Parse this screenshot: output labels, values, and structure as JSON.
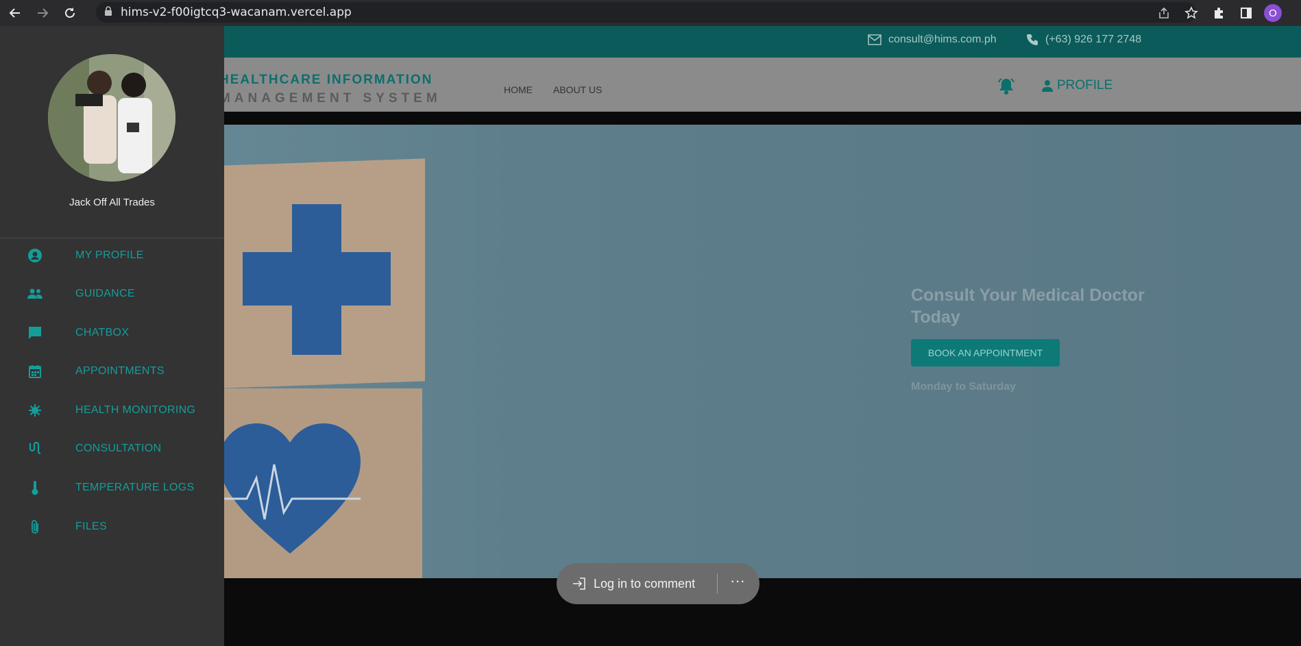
{
  "browser": {
    "url": "hims-v2-f00igtcq3-wacanam.vercel.app",
    "profile_initial": "O"
  },
  "topbar": {
    "email": "consult@hims.com.ph",
    "phone": "(+63) 926 177 2748"
  },
  "header": {
    "brand_line1": "HEALTHCARE INFORMATION",
    "brand_line2": "MANAGEMENT SYSTEM",
    "nav": [
      "HOME",
      "ABOUT US"
    ],
    "profile_label": "PROFILE"
  },
  "hero": {
    "title": "Consult Your Medical Doctor Today",
    "cta": "BOOK AN APPOINTMENT",
    "days": "Monday to Saturday"
  },
  "sidebar": {
    "username": "Jack Off All Trades",
    "items": [
      {
        "label": "MY PROFILE",
        "icon": "account-circle-icon"
      },
      {
        "label": "GUIDANCE",
        "icon": "people-icon"
      },
      {
        "label": "CHATBOX",
        "icon": "chat-icon"
      },
      {
        "label": "APPOINTMENTS",
        "icon": "calendar-icon"
      },
      {
        "label": "HEALTH MONITORING",
        "icon": "virus-icon"
      },
      {
        "label": "CONSULTATION",
        "icon": "stethoscope-icon"
      },
      {
        "label": "TEMPERATURE LOGS",
        "icon": "thermometer-icon"
      },
      {
        "label": "FILES",
        "icon": "paperclip-icon"
      }
    ]
  },
  "comment_bar": {
    "login_label": "Log in to comment",
    "more_label": "···"
  },
  "colors": {
    "accent": "#139e9b",
    "teal_dark": "#0c6e6d",
    "sidebar_bg": "#333333"
  }
}
